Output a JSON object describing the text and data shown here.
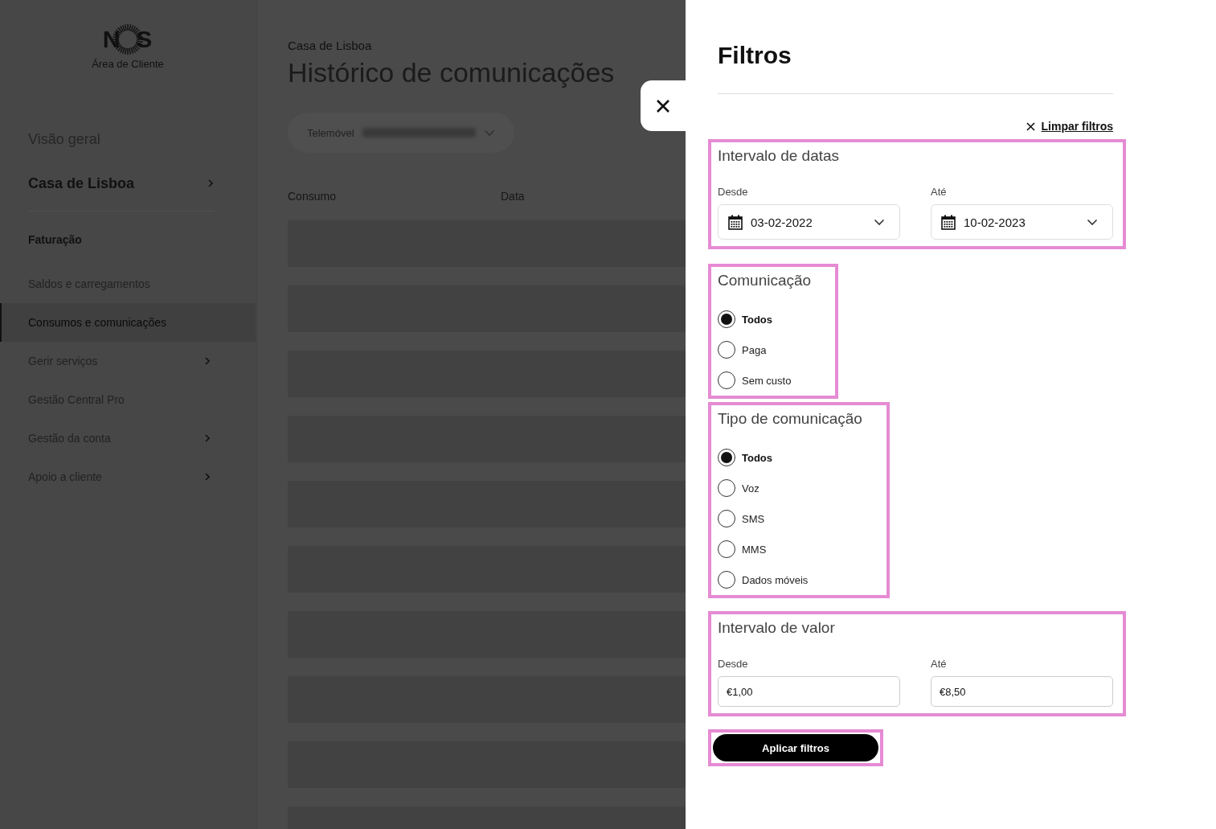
{
  "logo": {
    "brand": "N  S",
    "subtitle": "Área de Cliente"
  },
  "sidebar": {
    "items": [
      {
        "label": "Visão geral",
        "kind": "top",
        "chevron": false,
        "selected": false
      },
      {
        "label": "Casa de Lisboa",
        "kind": "account",
        "chevron": true,
        "selected": false
      },
      {
        "label": "Faturação",
        "kind": "heading",
        "chevron": false,
        "selected": false
      },
      {
        "label": "Saldos e carregamentos",
        "kind": "item",
        "chevron": false,
        "selected": false
      },
      {
        "label": "Consumos e comunicações",
        "kind": "item",
        "chevron": false,
        "selected": true
      },
      {
        "label": "Gerir serviços",
        "kind": "item",
        "chevron": true,
        "selected": false
      },
      {
        "label": "Gestão Central Pro",
        "kind": "item",
        "chevron": false,
        "selected": false
      },
      {
        "label": "Gestão da conta",
        "kind": "item",
        "chevron": true,
        "selected": false
      },
      {
        "label": "Apoio a cliente",
        "kind": "item",
        "chevron": true,
        "selected": false
      }
    ]
  },
  "page": {
    "breadcrumb": "Casa de Lisboa",
    "title": "Histórico de comunicações",
    "line_selector": {
      "label": "Telemóvel"
    },
    "table": {
      "columns": [
        "Consumo",
        "Data"
      ]
    }
  },
  "filters": {
    "title": "Filtros",
    "clear": "Limpar filtros",
    "sections": [
      {
        "kind": "date_range",
        "title": "Intervalo de datas",
        "from_label": "Desde",
        "from": "03-02-2022",
        "to_label": "Até",
        "to": "10-02-2023"
      },
      {
        "kind": "radio",
        "title": "Comunicação",
        "options": [
          {
            "label": "Todos",
            "selected": true
          },
          {
            "label": "Paga",
            "selected": false
          },
          {
            "label": "Sem custo",
            "selected": false
          }
        ]
      },
      {
        "kind": "radio",
        "title": "Tipo de comunicação",
        "options": [
          {
            "label": "Todos",
            "selected": true
          },
          {
            "label": "Voz",
            "selected": false
          },
          {
            "label": "SMS",
            "selected": false
          },
          {
            "label": "MMS",
            "selected": false
          },
          {
            "label": "Dados móveis",
            "selected": false
          }
        ]
      },
      {
        "kind": "value_range",
        "title": "Intervalo de valor",
        "from_label": "Desde",
        "from": "€1,00",
        "to_label": "Até",
        "to": "€8,50"
      }
    ],
    "apply": "Aplicar filtros"
  }
}
